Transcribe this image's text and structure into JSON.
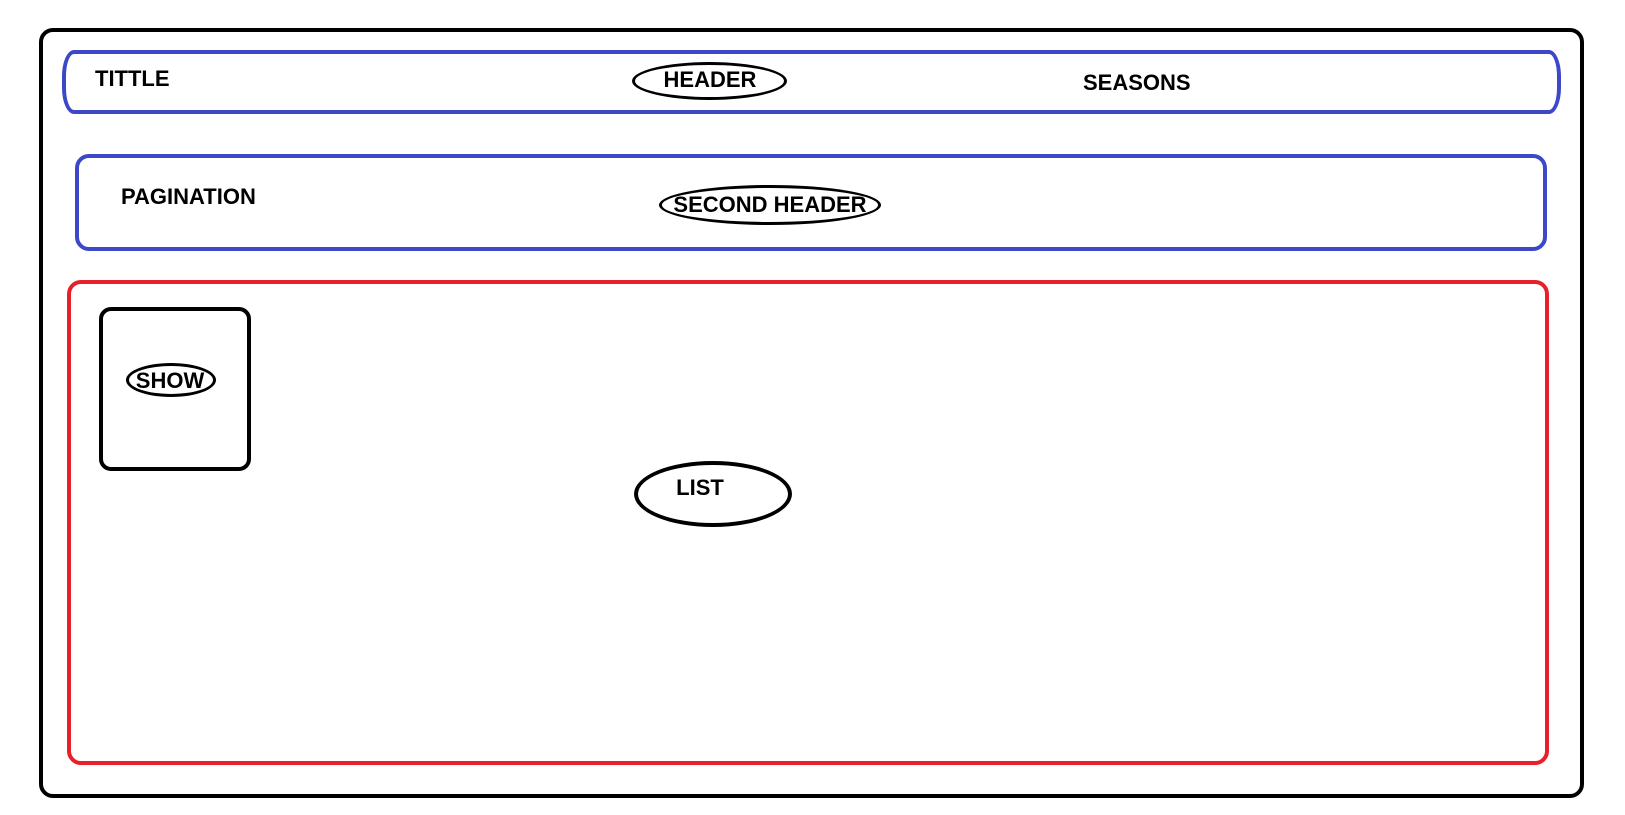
{
  "header": {
    "title_label": "TITTLE",
    "header_label": "HEADER",
    "seasons_label": "SEASONS"
  },
  "second_header": {
    "pagination_label": "PAGINATION",
    "second_header_label": "SECOND HEADER"
  },
  "list": {
    "list_label": "LIST",
    "show_label": "SHOW"
  },
  "colors": {
    "header_border": "#3c48c8",
    "list_border": "#e8202a",
    "frame_border": "#000000"
  }
}
